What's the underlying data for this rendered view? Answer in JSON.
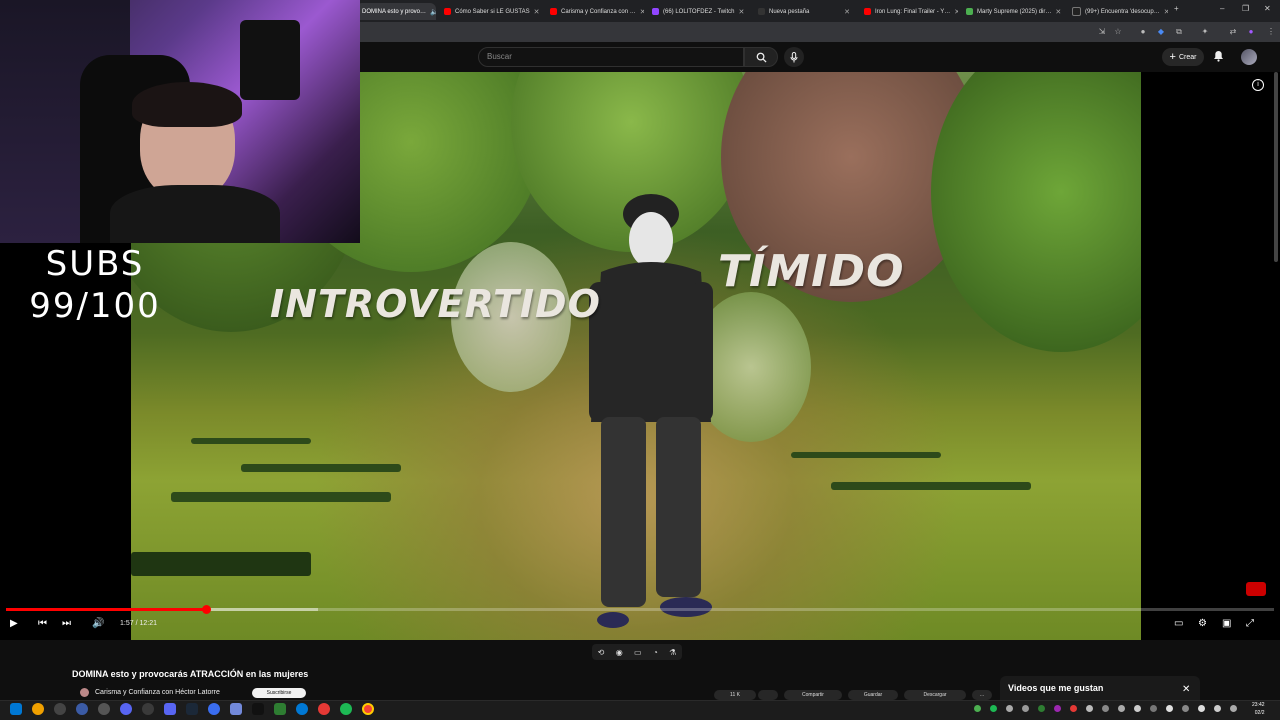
{
  "browser": {
    "tabs": [
      {
        "label": "DOMINA esto y provo…",
        "active": true,
        "favicon_color": "#ff0000"
      },
      {
        "label": "Cómo Saber si LE GUSTAS",
        "favicon_color": "#ff0000"
      },
      {
        "label": "Carisma y Confianza con …",
        "favicon_color": "#ff0000"
      },
      {
        "label": "(66) LOLITOFDEZ - Twitch",
        "favicon_color": "#9146ff"
      },
      {
        "label": "Nueva pestaña",
        "favicon_color": "#333333"
      },
      {
        "label": "Iron Lung: Final Trailer - Y…",
        "favicon_color": "#ff0000"
      },
      {
        "label": "Marty Supreme (2025) dir…",
        "favicon_color": "#4caf50"
      },
      {
        "label": "(99+) Encuentra 'desocup…",
        "favicon_color": "#222222"
      }
    ],
    "new_tab": "+",
    "window_controls": [
      "–",
      "❐",
      "✕"
    ]
  },
  "youtube": {
    "search_placeholder": "Buscar",
    "search_icon": "search-icon",
    "mic_icon": "mic-icon",
    "create_label": "Crear",
    "create_icon": "+",
    "bell_icon": "bell-icon"
  },
  "video": {
    "overlay_word_left": "INTROVERTIDO",
    "overlay_word_right": "TÍMIDO",
    "time_current": "1:57",
    "time_total": "12:21",
    "timecode": "1:57 / 12:21",
    "progress_fraction": 0.158,
    "buffered_fraction": 0.246,
    "accent_color": "#ff0000"
  },
  "stream_overlay": {
    "subs_label": "SUBS",
    "subs_count": "99/100"
  },
  "below_video": {
    "title": "DOMINA esto y provocarás ATRACCIÓN en las mujeres",
    "channel": "Carisma y Confianza con Héctor Latorre",
    "subscribe_label": "Suscribirse",
    "actions": [
      "11 K",
      "",
      "Compartir",
      "Guardar",
      "Descargar"
    ]
  },
  "liked_panel": {
    "title": "Videos que me gustan",
    "close_icon": "close-icon"
  },
  "taskbar": {
    "time": "23:42",
    "date": "02/2"
  }
}
